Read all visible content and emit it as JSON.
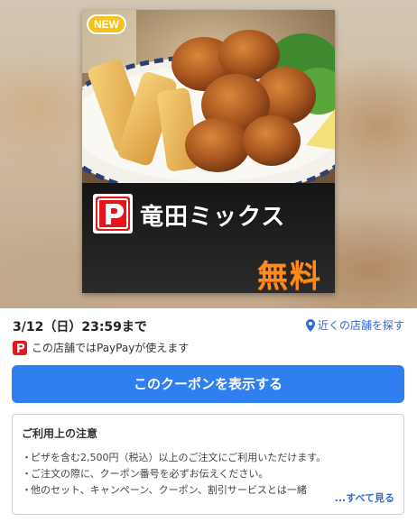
{
  "coupon": {
    "badge": "NEW",
    "product_name": "竜田ミックス",
    "price_label": "無料",
    "accent_color": "#ff8c1a",
    "brand_color": "#e8141c",
    "logo_icon": "pizza-brand-p-logo"
  },
  "validity": {
    "expiry_text": "3/12（日）23:59まで"
  },
  "store_search": {
    "icon": "location-pin-icon",
    "label": "近くの店舗を探す"
  },
  "payment": {
    "icon": "paypay-icon",
    "text": "この店舗ではPayPayが使えます"
  },
  "cta": {
    "label": "このクーポンを表示する",
    "color": "#2f7ff0"
  },
  "notice": {
    "title": "ご利用上の注意",
    "bullet": "・",
    "items": [
      "ピザを含む2,500円（税込）以上のご注文にご利用いただけます。",
      "ご注文の際に、クーポン番号を必ずお伝えください。",
      "他のセット、キャンペーン、クーポン、割引サービスとは一緒"
    ],
    "see_all": "...すべて見る"
  }
}
